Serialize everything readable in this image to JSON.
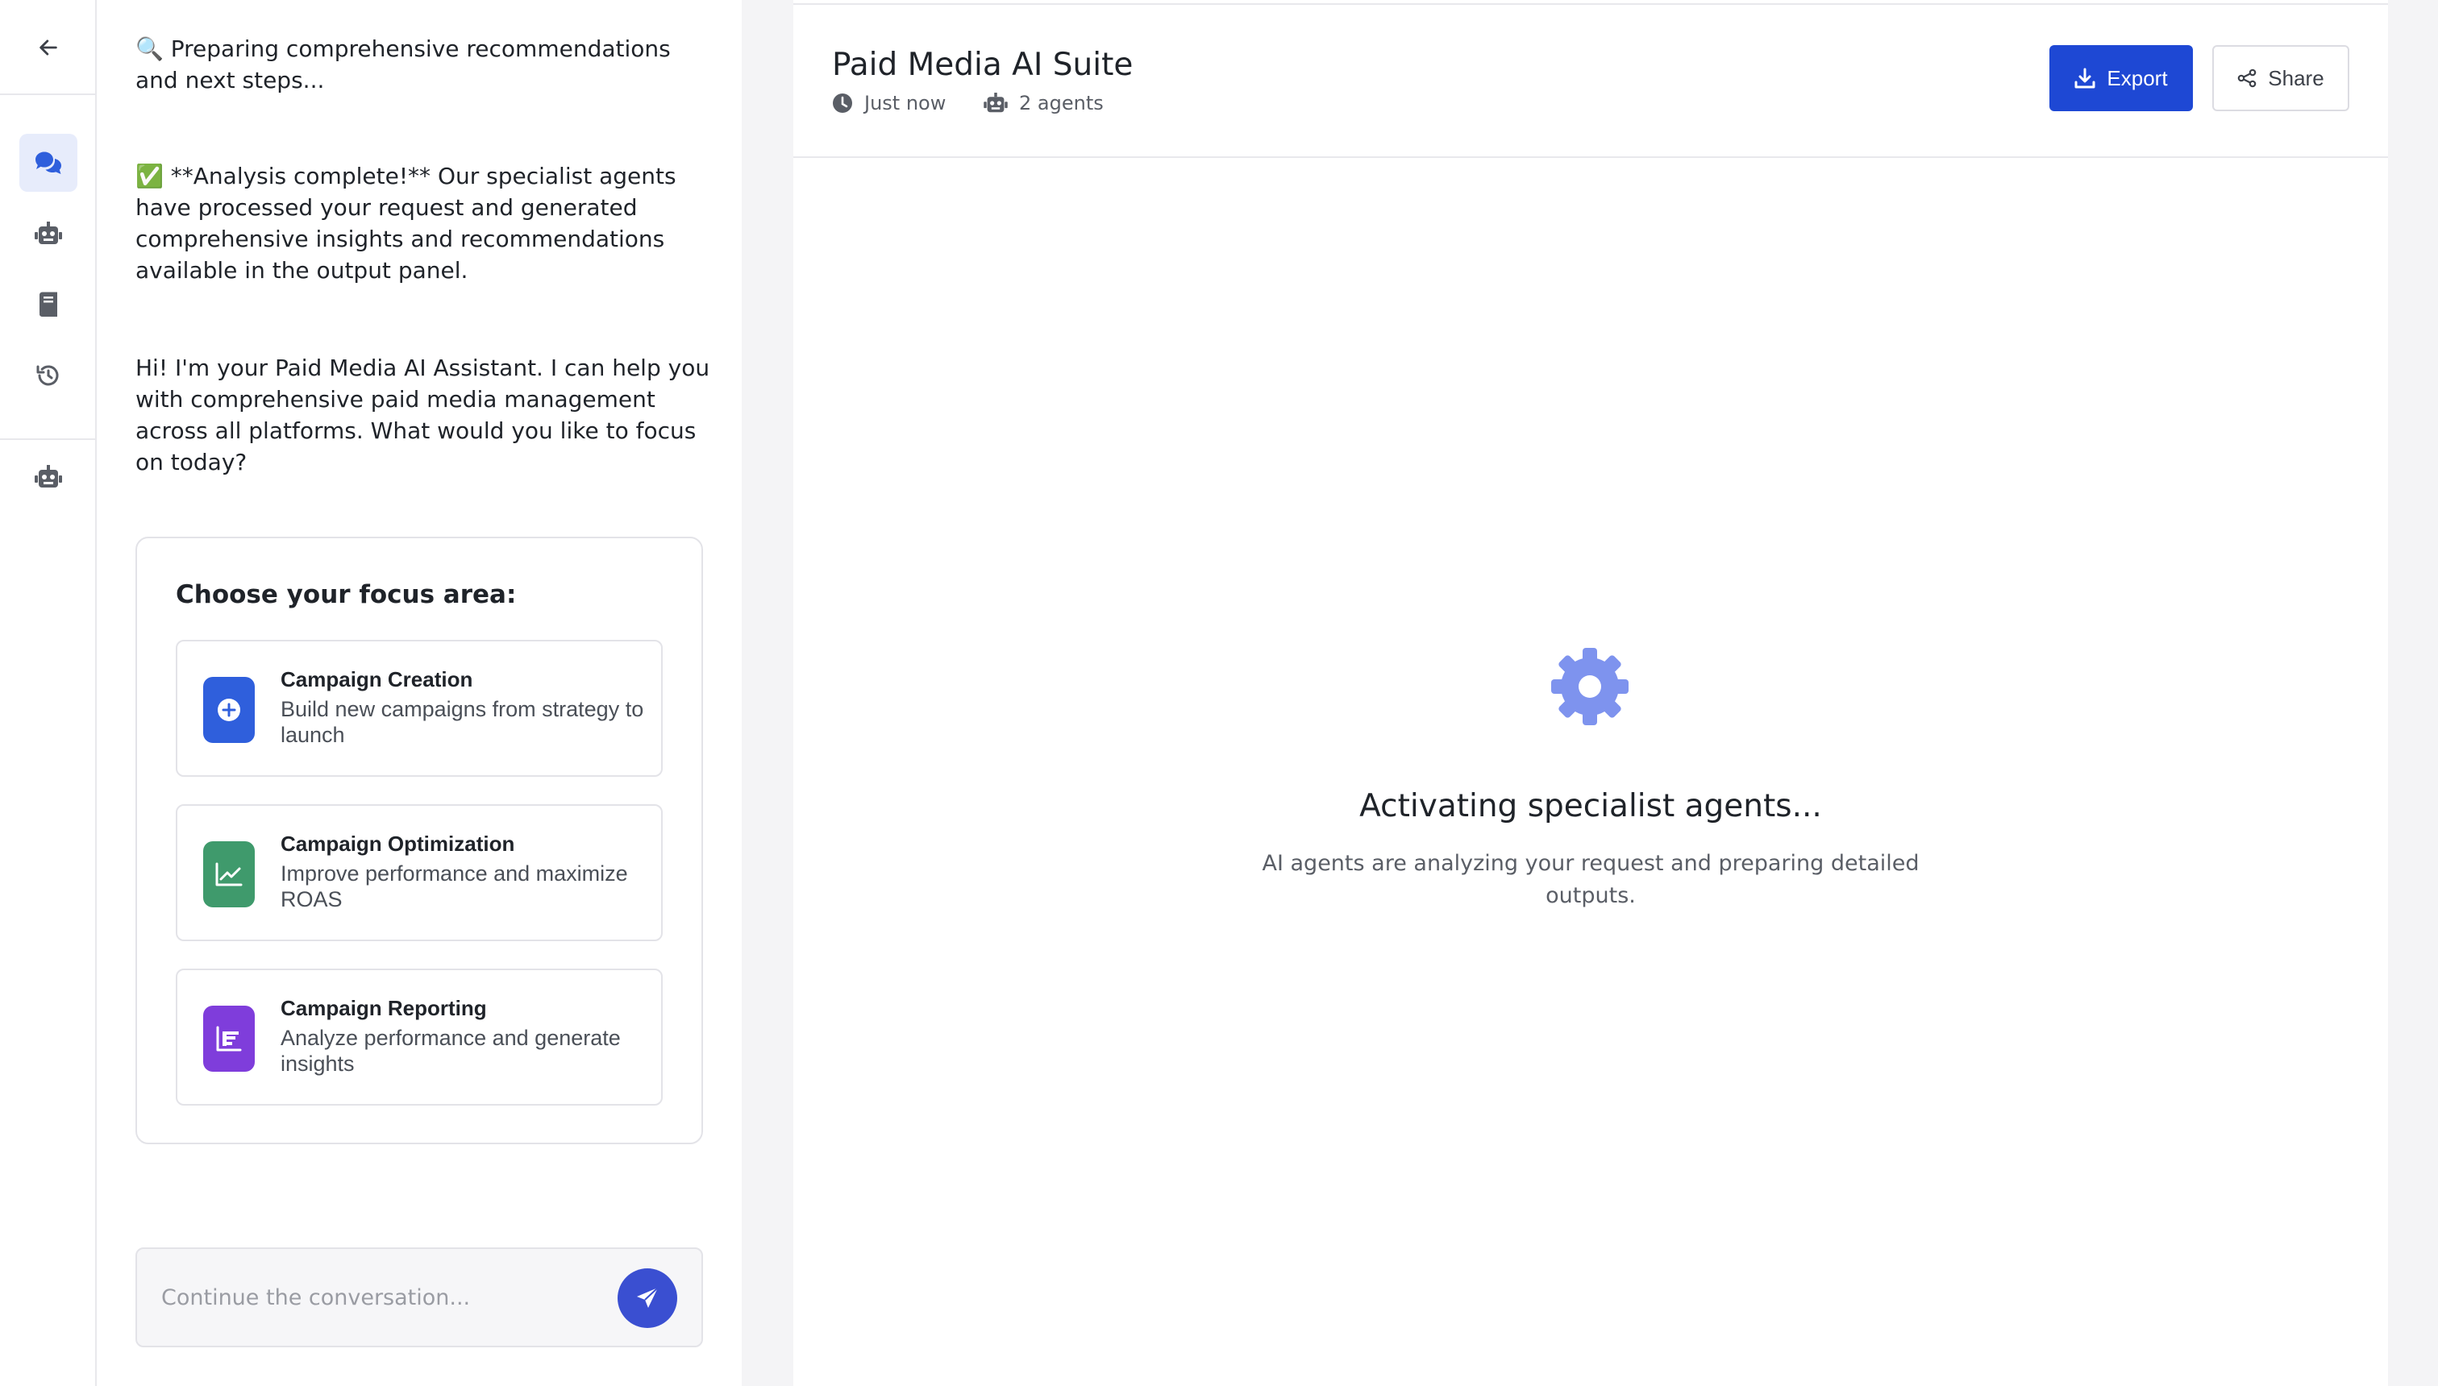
{
  "rail": {
    "items": [
      {
        "name": "back-icon"
      },
      {
        "name": "chat-icon",
        "active": true
      },
      {
        "name": "robot-icon"
      },
      {
        "name": "book-icon"
      },
      {
        "name": "history-icon"
      },
      {
        "name": "robot-icon"
      }
    ]
  },
  "chat": {
    "messages": [
      "🔍 Preparing comprehensive recommendations and next steps...",
      "✅ **Analysis complete!** Our specialist agents have processed your request and generated comprehensive insights and recommendations available in the output panel.",
      "Hi! I'm your Paid Media AI Assistant. I can help you with comprehensive paid media management across all platforms. What would you like to focus on today?"
    ],
    "focus": {
      "title": "Choose your focus area:",
      "options": [
        {
          "title": "Campaign Creation",
          "desc": "Build new campaigns from strategy to launch",
          "icon": "plus-circle-icon",
          "color": "#2f5fdc"
        },
        {
          "title": "Campaign Optimization",
          "desc": "Improve performance and maximize ROAS",
          "icon": "trend-chart-icon",
          "color": "#3f9a6c"
        },
        {
          "title": "Campaign Reporting",
          "desc": "Analyze performance and generate insights",
          "icon": "bar-chart-icon",
          "color": "#7f3ddb"
        }
      ]
    },
    "composer": {
      "placeholder": "Continue the conversation..."
    }
  },
  "panel": {
    "title": "Paid Media AI Suite",
    "time": "Just now",
    "agents": "2 agents",
    "export_label": "Export",
    "share_label": "Share",
    "status_title": "Activating specialist agents...",
    "status_desc": "AI agents are analyzing your request and preparing detailed outputs."
  },
  "colors": {
    "accent": "#1e48d4",
    "gear": "#7e93ee",
    "active_rail": "#e7ecfb"
  }
}
